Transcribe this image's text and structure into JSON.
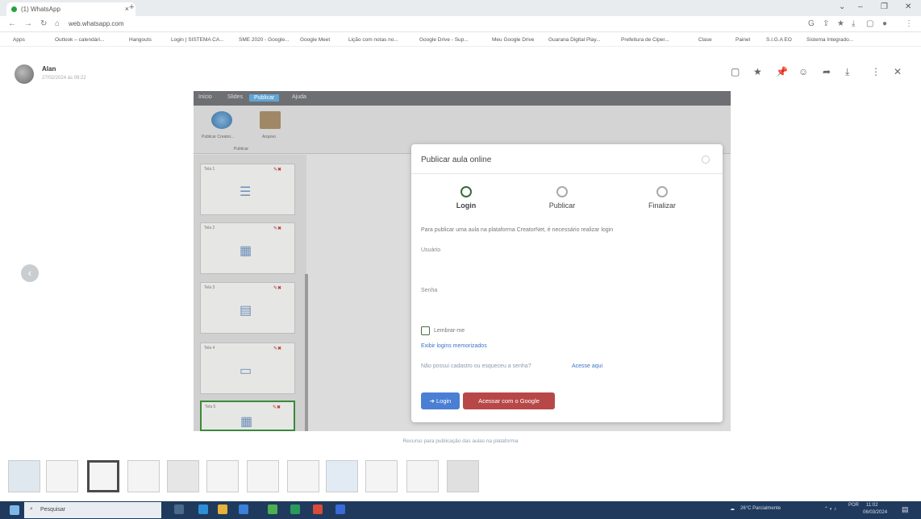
{
  "browser": {
    "tab_title": "(1) WhatsApp",
    "url": "web.whatsapp.com",
    "bookmarks": [
      "Apps",
      "Outlook – calendári...",
      "Hangouts",
      "Login | SISTEMA CA...",
      "SME 2020 - Google...",
      "Google Meet",
      "Lição com notas no...",
      "Google Drive - Sup...",
      "Meu Google Drive",
      "Guarana Digital Play...",
      "Prefeitura de Ciper...",
      "Clase",
      "Painel",
      "S.I.G.A EO",
      "Sistema Integrado..."
    ]
  },
  "chat_header": {
    "user": "Alan",
    "date": "27/02/2024 às 09:22"
  },
  "app": {
    "menu": [
      "Início",
      "Slides",
      "Publicar",
      "Ajuda"
    ],
    "active_menu": "Publicar",
    "tools": [
      "Publicar Creator...",
      "Arquivo"
    ],
    "group_label": "Publicar",
    "slides": [
      "Tela 1",
      "Tela 2",
      "Tela 3",
      "Tela 4",
      "Tela 5"
    ]
  },
  "modal": {
    "title": "Publicar aula online",
    "steps": [
      "Login",
      "Publicar",
      "Finalizar"
    ],
    "active_step": "Login",
    "info": "Para publicar uma aula na plataforma CreatorNet, é necessário realizar login",
    "user_label": "Usuário",
    "user_value": "",
    "pass_label": "Senha",
    "pass_value": "",
    "remember": "Lembrar-me",
    "remember_checked": false,
    "saved_logins": "Exibir logins memorizados",
    "no_account": "Não possui cadastro ou esqueceu a senha?",
    "click_here": "Acesse aqui",
    "login_btn": "Login",
    "google_btn": "Acessar com o Google",
    "login_color": "#4a7fd4",
    "google_color": "#b84848"
  },
  "caption": "Recurso para publicação das aulas na plataforma",
  "taskbar": {
    "search": "Pesquisar",
    "weather": "26°C Parcialmente",
    "lang": "POR",
    "time": "11:02",
    "date": "06/03/2024"
  }
}
